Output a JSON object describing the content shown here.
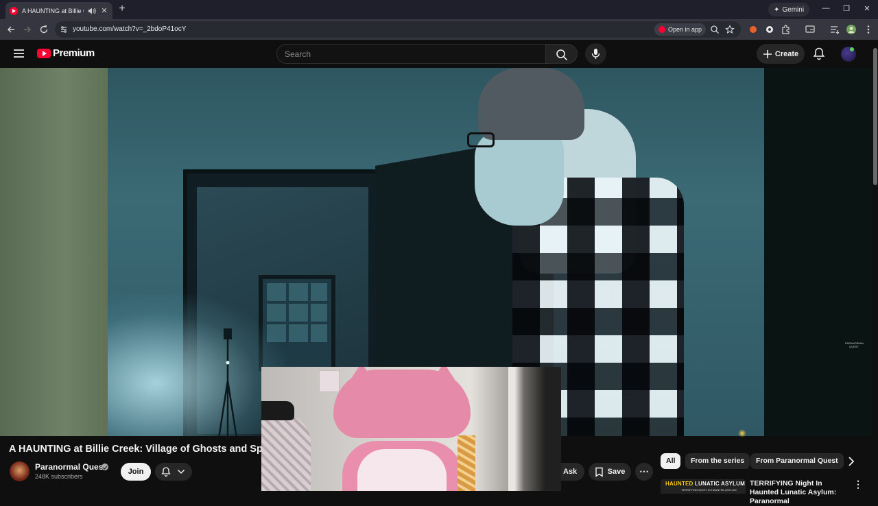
{
  "browser": {
    "tab_title": "A HAUNTING at Billie Creek: Village of Ghosts and Spirits - YouTube",
    "tab_close": "✕",
    "new_tab": "+",
    "gemini_label": "Gemini",
    "url": "youtube.com/watch?v=_2bdoP41ocY",
    "open_in_app_label": "Open in app",
    "window_controls": {
      "minimize": "—",
      "restore": "❐",
      "close": "✕"
    }
  },
  "header": {
    "logo_text": "Premium",
    "search_placeholder": "Search",
    "create_label": "Create"
  },
  "video": {
    "title": "A HAUNTING at Billie Creek: Village of Ghosts and Spirit",
    "watermark": "PARANORMAL QUEST"
  },
  "channel": {
    "name": "Paranormal Quest",
    "subscribers": "248K subscribers",
    "join_label": "Join"
  },
  "actions": {
    "ask_label": "Ask",
    "save_label": "Save",
    "more_label": "⋯"
  },
  "chips": [
    {
      "label": "All",
      "active": true
    },
    {
      "label": "From the series",
      "active": false
    },
    {
      "label": "From Paranormal Quest",
      "active": false
    }
  ],
  "recommendation": {
    "thumb_text_a": "HAUNTED",
    "thumb_text_b": " LUNATIC ASYLUM",
    "thumb_subtext": "TERRIFYING NIGHT IN HAUNTED ASYLUM",
    "title": "TERRIFYING Night In Haunted Lunatic Asylum: Paranormal",
    "more": "⋮"
  },
  "colors": {
    "brand_red": "#ff0033",
    "background": "#0f0f0f",
    "chip_bg": "#272727"
  }
}
